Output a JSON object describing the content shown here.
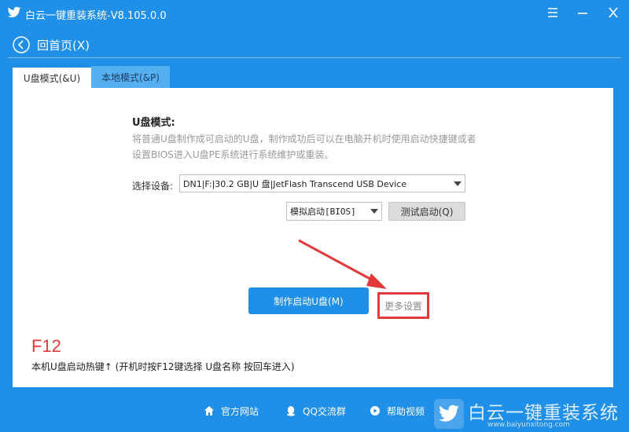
{
  "window": {
    "title": "白云一键重装系统-V8.105.0.0",
    "logo_icon": "bird-logo-icon",
    "controls": [
      "menu-icon",
      "minimize-icon",
      "close-icon"
    ]
  },
  "nav": {
    "back_label": "回首页(X)",
    "back_icon": "back-arrow-icon"
  },
  "tabs": [
    {
      "label": "U盘模式(&U)",
      "active": true
    },
    {
      "label": "本地模式(&P)",
      "active": false
    }
  ],
  "usb_mode": {
    "title": "U盘模式:",
    "description": "将普通U盘制作成可启动的U盘，制作成功后可以在电脑开机时使用启动快捷键或者设置BIOS进入U盘PE系统进行系统维护或重装。",
    "device_label": "选择设备:",
    "device_value": "DN1|F:|30.2 GB|U 盘|JetFlash Transcend USB Device",
    "boot_mode_value": "模拟启动[BIOS]",
    "test_boot_label": "测试启动(Q)",
    "make_button_label": "制作启动U盘(M)",
    "more_settings_label": "更多设置"
  },
  "hotkey": {
    "key": "F12",
    "description": "本机U盘启动热键↑ (开机时按F12键选择 U盘名称 按回车进入)"
  },
  "footer": {
    "links": [
      {
        "label": "官方网站",
        "icon": "home-icon"
      },
      {
        "label": "QQ交流群",
        "icon": "qq-penguin-icon"
      },
      {
        "label": "帮助视频",
        "icon": "help-video-icon"
      }
    ]
  },
  "watermark": {
    "title": "白云一键重装系统",
    "url": "www.baiyunxitong.com"
  },
  "colors": {
    "brand_blue": "#1f8fe8",
    "annotation_red": "#e23a3a",
    "inactive_tab": "#55aff0"
  }
}
